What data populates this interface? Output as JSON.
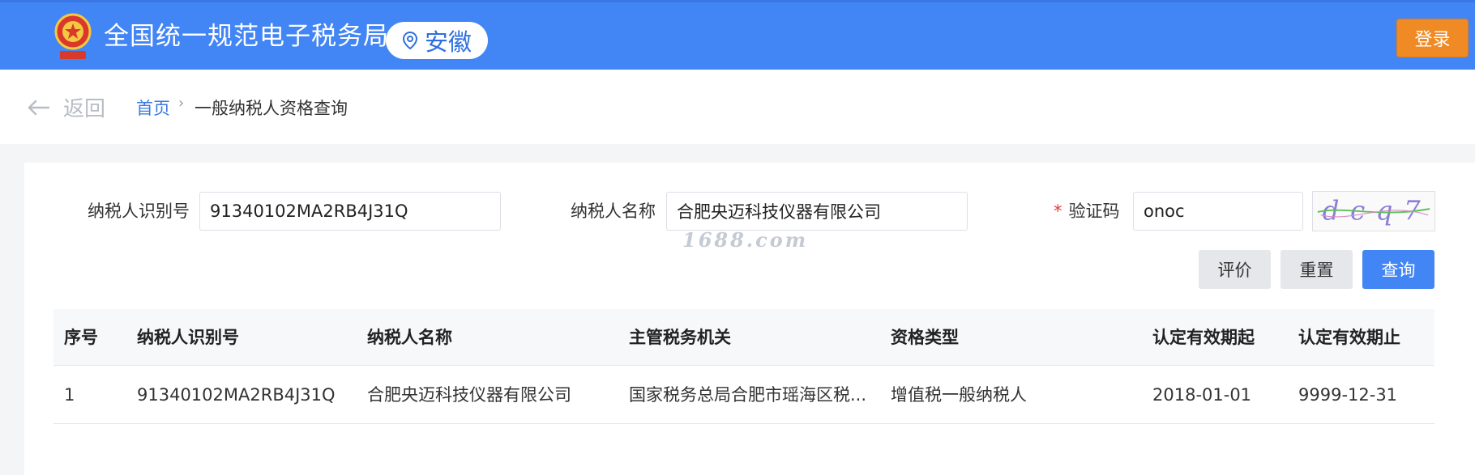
{
  "header": {
    "emblem_icon": "tax-emblem-icon",
    "site_title": "全国统一规范电子税务局",
    "region_icon": "location-pin-icon",
    "region": "安徽",
    "login_label": "登录",
    "colors": {
      "bar": "#4285f4",
      "login": "#f08a24"
    }
  },
  "breadcrumb": {
    "back_label": "返回",
    "home": "首页",
    "separator": "›",
    "current": "一般纳税人资格查询"
  },
  "form": {
    "taxpayer_id_label": "纳税人识别号",
    "taxpayer_id_value": "91340102MA2RB4J31Q",
    "taxpayer_name_label": "纳税人名称",
    "taxpayer_name_value": "合肥央迈科技仪器有限公司",
    "captcha_required": "*",
    "captcha_label": "验证码",
    "captcha_value": "onoc",
    "captcha_image_text": "dcq7"
  },
  "watermark": "1688.com",
  "buttons": {
    "evaluate": "评价",
    "reset": "重置",
    "query": "查询"
  },
  "table": {
    "headers": [
      "序号",
      "纳税人识别号",
      "纳税人名称",
      "主管税务机关",
      "资格类型",
      "认定有效期起",
      "认定有效期止"
    ],
    "rows": [
      [
        "1",
        "91340102MA2RB4J31Q",
        "合肥央迈科技仪器有限公司",
        "国家税务总局合肥市瑶海区税...",
        "增值税一般纳税人",
        "2018-01-01",
        "9999-12-31"
      ]
    ]
  }
}
